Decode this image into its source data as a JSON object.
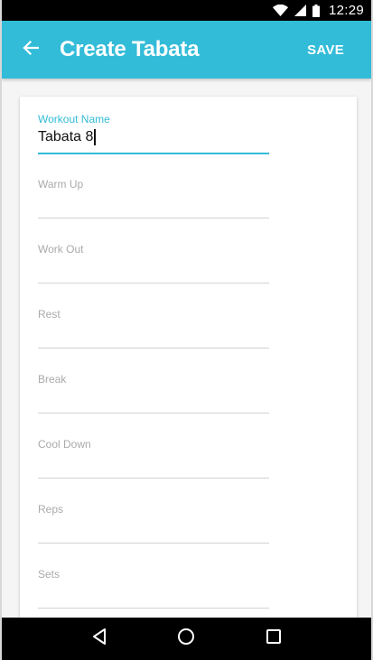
{
  "status_bar": {
    "time": "12:29",
    "icons": [
      "wifi-icon",
      "cell-signal-icon",
      "battery-icon"
    ]
  },
  "app_bar": {
    "title": "Create Tabata",
    "save_label": "SAVE",
    "back_icon": "arrow-back-icon"
  },
  "form": {
    "fields": [
      {
        "label": "Workout Name",
        "value": "Tabata 8",
        "focused": true
      },
      {
        "label": "Warm Up",
        "value": ""
      },
      {
        "label": "Work Out",
        "value": ""
      },
      {
        "label": "Rest",
        "value": ""
      },
      {
        "label": "Break",
        "value": ""
      },
      {
        "label": "Cool Down",
        "value": ""
      },
      {
        "label": "Reps",
        "value": ""
      },
      {
        "label": "Sets",
        "value": ""
      }
    ]
  },
  "nav_bar": {
    "icons": [
      "back-triangle-icon",
      "home-circle-icon",
      "recents-square-icon"
    ]
  },
  "colors": {
    "accent": "#32bcd8",
    "status_bar": "#000000",
    "label_inactive": "#aaaaaa"
  }
}
